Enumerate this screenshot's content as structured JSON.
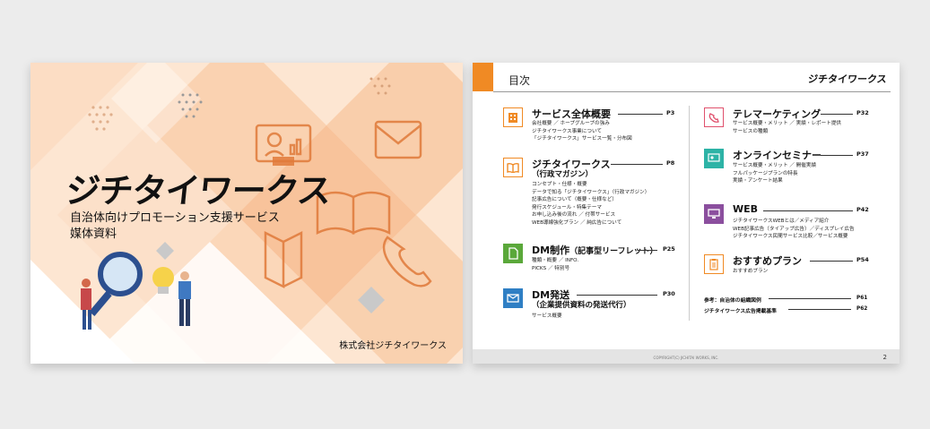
{
  "cover": {
    "logo": "ジチタイワークス",
    "subtitle_line1": "自治体向けプロモーション支援サービス",
    "subtitle_line2": "媒体資料",
    "company": "株式会社ジチタイワークス"
  },
  "toc": {
    "title": "目次",
    "brand": "ジチタイワークス",
    "copyright": "COPYRIGHT(C) JICHITAI WORKS, INC.",
    "page_number": "2",
    "left_entries": [
      {
        "title": "サービス全体概要",
        "subtitle": "",
        "page": "P3",
        "lines": [
          "会社概要 ／ ホープグループの強み",
          "ジチタイワークス事業について",
          "「ジチタイワークス」サービス一覧・分布図"
        ],
        "icon": "building-icon",
        "color": "#f08a24"
      },
      {
        "title": "ジチタイワークス",
        "subtitle": "（行政マガジン）",
        "page": "P8",
        "lines": [
          "コンセプト・仕様・概要",
          "データで知る「ジチタイワークス」（行政マガジン）",
          "記事広告について（概要・仕様など）",
          "発行スケジュール・特集テーマ",
          "お申し込み後の流れ ／ 付帯サービス",
          "WEB導線強化プラン ／ 純広告について"
        ],
        "icon": "book-icon",
        "color": "#f08a24"
      },
      {
        "title": "DM制作",
        "title_small": "（記事型リーフレット）",
        "subtitle": "",
        "page": "P25",
        "lines": [
          "種類・概要 ／ INFO.",
          "PICKS ／ 特別号"
        ],
        "icon": "leaflet-icon",
        "color": "#5aa83a"
      },
      {
        "title": "DM発送",
        "subtitle": "（企業提供資料の発送代行）",
        "page": "P30",
        "lines": [
          "サービス概要"
        ],
        "icon": "mail-icon",
        "color": "#2f7fc4"
      }
    ],
    "right_entries": [
      {
        "title": "テレマーケティング",
        "page": "P32",
        "lines": [
          "サービス概要・メリット ／ 実績・レポート提供",
          "サービスの種類"
        ],
        "icon": "phone-icon",
        "color": "#e0516d"
      },
      {
        "title": "オンラインセミナー",
        "page": "P37",
        "lines": [
          "サービス概要・メリット ／ 開催実績",
          "フルパッケージプランの特長",
          "実績・アンケート結果"
        ],
        "icon": "presenter-icon",
        "color": "#2db3a6"
      },
      {
        "title": "WEB",
        "page": "P42",
        "lines": [
          "ジチタイワークスWEBとは／メディア紹介",
          "WEB記事広告（タイアップ広告）／ディスプレイ広告",
          "ジチタイワークス民間サービス比較／サービス概要"
        ],
        "icon": "monitor-icon",
        "color": "#8b4f9e"
      },
      {
        "title": "おすすめプラン",
        "page": "P54",
        "lines": [
          "おすすめプラン"
        ],
        "icon": "clipboard-icon",
        "color": "#f08a24"
      }
    ],
    "references": [
      {
        "label": "参考：自治体の組織図例",
        "page": "P61"
      },
      {
        "label": "ジチタイワークス広告掲載基準",
        "page": "P62"
      }
    ]
  }
}
